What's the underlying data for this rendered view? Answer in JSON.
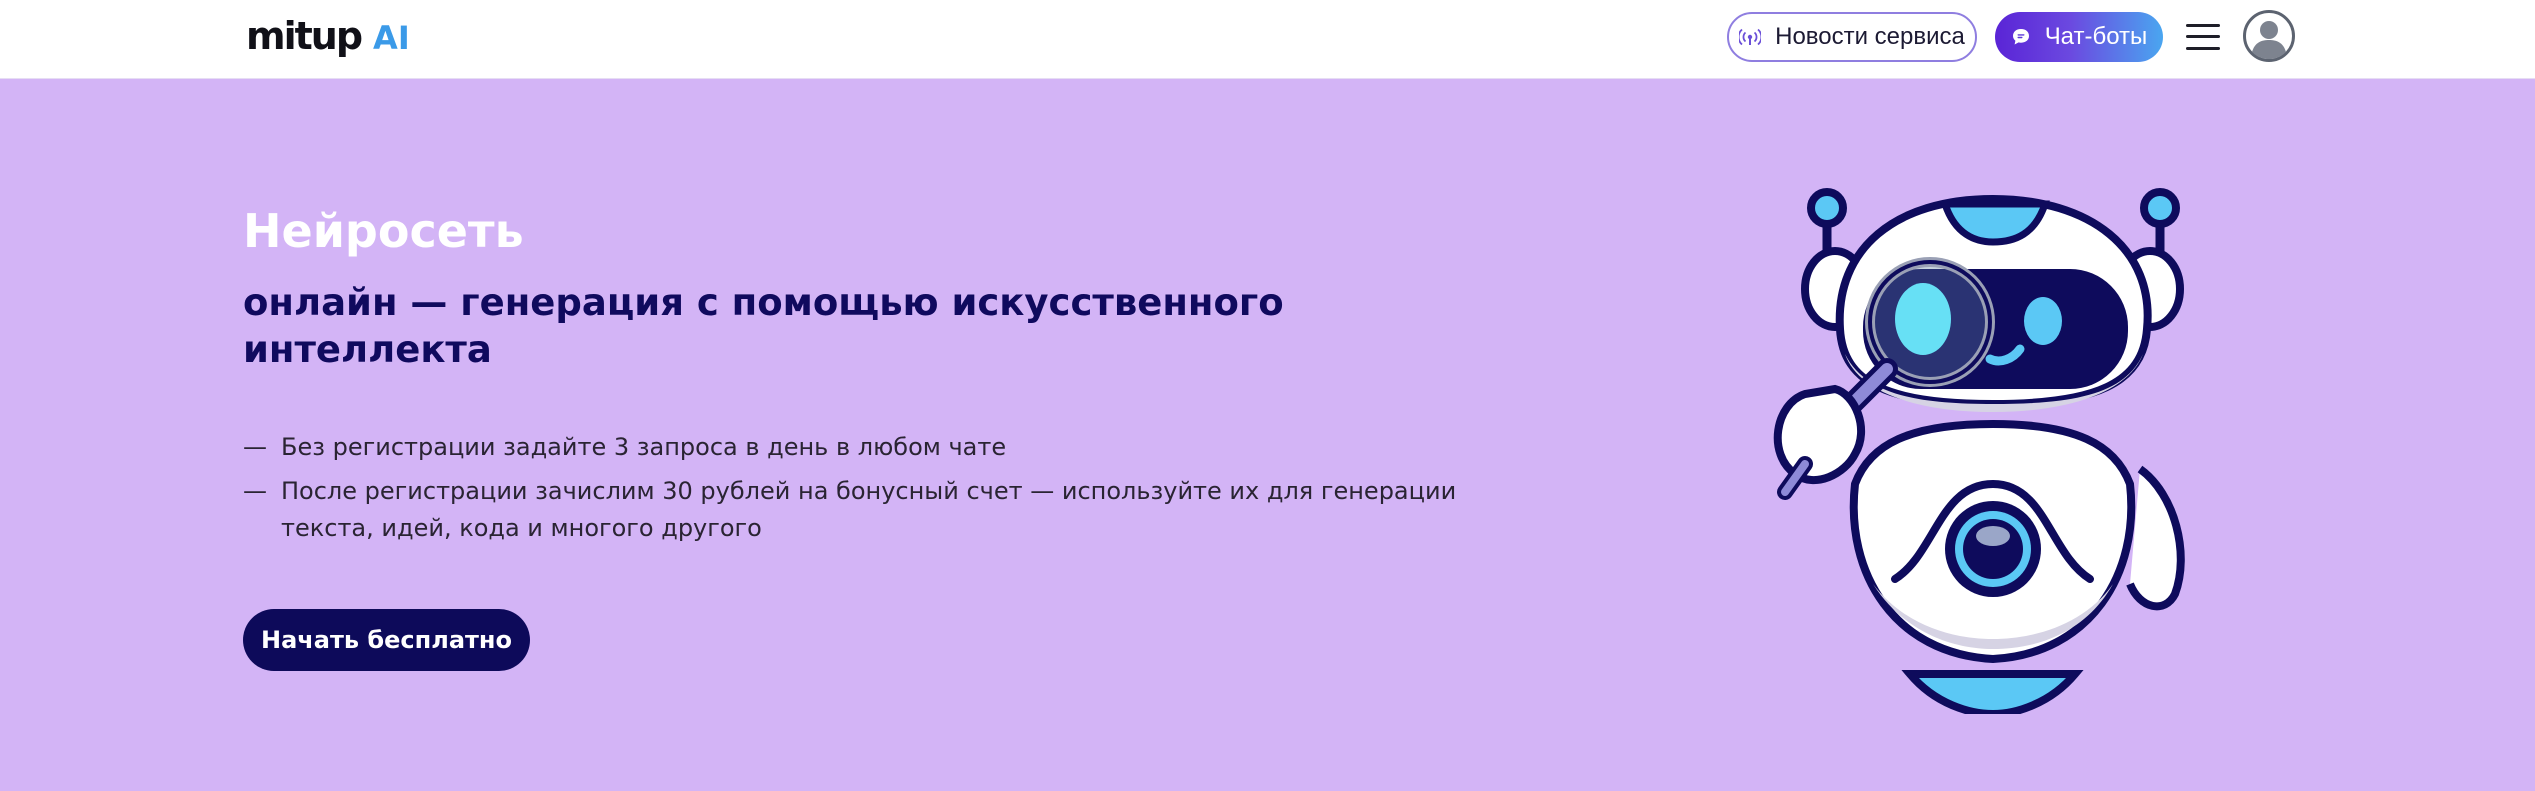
{
  "header": {
    "logo": {
      "brand": "mitup",
      "accent": "AI"
    },
    "news_button": {
      "label": "Новости сервиса",
      "icon": "broadcast-icon"
    },
    "bots_button": {
      "label": "Чат-боты",
      "icon": "chat-bubble-icon"
    },
    "menu_icon": "hamburger-menu-icon",
    "avatar_icon": "user-avatar-icon"
  },
  "hero": {
    "title": "Нейросеть",
    "subtitle": "онлайн — генерация с помощью искусственного интеллекта",
    "bullets": [
      {
        "dash": "—",
        "text": "Без регистрации задайте 3 запроса в день в любом чате"
      },
      {
        "dash": "—",
        "text": "После регистрации зачислим 30 рублей на бонусный счет — используйте их для генерации текста, идей, кода и многого другого"
      }
    ],
    "cta_label": "Начать бесплатно",
    "illustration": "robot-with-magnifier-illustration"
  },
  "colors": {
    "hero_background": "#d3b4f6",
    "heading_dark": "#100a5e",
    "cta_background": "#0d0a5a",
    "logo_accent": "#3b9ae8",
    "bots_gradient_start": "#5a24d6",
    "bots_gradient_end": "#4aa6f0"
  }
}
